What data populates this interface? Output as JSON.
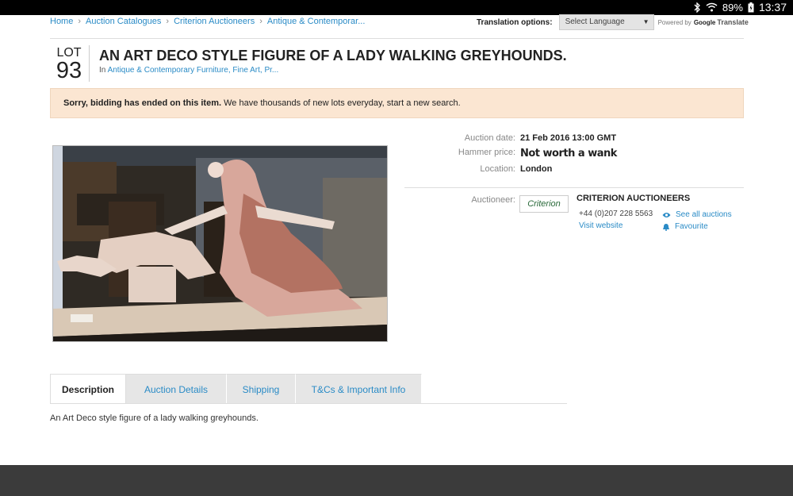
{
  "status_bar": {
    "battery": "89%",
    "time": "13:37",
    "icons": [
      "bluetooth-icon",
      "wifi-icon",
      "battery-icon"
    ]
  },
  "breadcrumb": {
    "items": [
      "Home",
      "Auction Catalogues",
      "Criterion Auctioneers",
      "Antique & Contemporar..."
    ],
    "separator": "›"
  },
  "translation": {
    "label": "Translation options:",
    "select_value": "Select Language",
    "powered_by": "Powered by",
    "google": "Google",
    "translate": "Translate"
  },
  "lot": {
    "lot_label": "LOT",
    "number": "93",
    "title": "AN ART DECO STYLE FIGURE OF A LADY WALKING GREYHOUNDS.",
    "in_label": "In",
    "category_link": "Antique & Contemporary Furniture, Fine Art, Pr..."
  },
  "notice": {
    "bold": "Sorry, bidding has ended on this item.",
    "text": " We have thousands of new lots everyday, start a new search."
  },
  "details": {
    "auction_date_label": "Auction date:",
    "auction_date": "21 Feb 2016 13:00 GMT",
    "hammer_price_label": "Hammer price:",
    "hammer_price": "Not worth a wank",
    "location_label": "Location:",
    "location": "London"
  },
  "auctioneer": {
    "label": "Auctioneer:",
    "logo_text": "Criterion",
    "name": "CRITERION AUCTIONEERS",
    "phone": "+44 (0)207 228 5563",
    "website": "Visit website",
    "see_all": "See all auctions",
    "favourite": "Favourite"
  },
  "tabs": [
    {
      "label": "Description",
      "active": true
    },
    {
      "label": "Auction Details",
      "active": false
    },
    {
      "label": "Shipping",
      "active": false
    },
    {
      "label": "T&Cs & Important Info",
      "active": false
    }
  ],
  "description": "An Art Deco style figure of a lady walking greyhounds.",
  "colors": {
    "link": "#2a8bc6",
    "notice_bg": "#fbe6d2",
    "footer": "#3b3b3b"
  }
}
